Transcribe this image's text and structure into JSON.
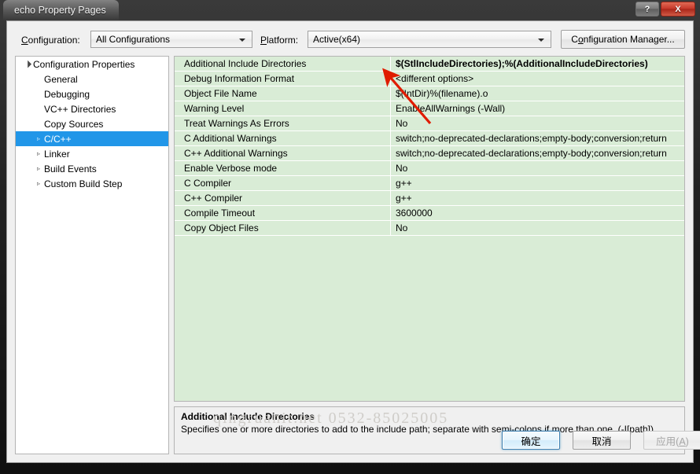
{
  "window": {
    "title": "echo Property Pages",
    "help_button": "?",
    "close_button": "X"
  },
  "toolbar": {
    "configuration_label": "Configuration:",
    "configuration_accel": "C",
    "configuration_value": "All Configurations",
    "platform_label": "Platform:",
    "platform_accel": "P",
    "platform_value": "Active(x64)",
    "config_manager_label": "Configuration Manager...",
    "config_manager_accel": "o"
  },
  "tree": {
    "items": [
      {
        "label": "Configuration Properties",
        "depth": 0,
        "twisty": "expanded",
        "selected": false
      },
      {
        "label": "General",
        "depth": 1,
        "twisty": "none",
        "selected": false
      },
      {
        "label": "Debugging",
        "depth": 1,
        "twisty": "none",
        "selected": false
      },
      {
        "label": "VC++ Directories",
        "depth": 1,
        "twisty": "none",
        "selected": false
      },
      {
        "label": "Copy Sources",
        "depth": 1,
        "twisty": "none",
        "selected": false
      },
      {
        "label": "C/C++",
        "depth": 1,
        "twisty": "collapsed",
        "selected": true
      },
      {
        "label": "Linker",
        "depth": 1,
        "twisty": "collapsed",
        "selected": false
      },
      {
        "label": "Build Events",
        "depth": 1,
        "twisty": "collapsed",
        "selected": false
      },
      {
        "label": "Custom Build Step",
        "depth": 1,
        "twisty": "collapsed",
        "selected": false
      }
    ]
  },
  "grid": {
    "rows": [
      {
        "name": "Additional Include Directories",
        "value": "$(StlIncludeDirectories);%(AdditionalIncludeDirectories)",
        "active": true
      },
      {
        "name": "Debug Information Format",
        "value": "<different options>",
        "active": false
      },
      {
        "name": "Object File Name",
        "value": "$(IntDir)%(filename).o",
        "active": false
      },
      {
        "name": "Warning Level",
        "value": "EnableAllWarnings (-Wall)",
        "active": false
      },
      {
        "name": "Treat Warnings As Errors",
        "value": "No",
        "active": false
      },
      {
        "name": "C Additional Warnings",
        "value": "switch;no-deprecated-declarations;empty-body;conversion;return",
        "active": false
      },
      {
        "name": "C++ Additional Warnings",
        "value": "switch;no-deprecated-declarations;empty-body;conversion;return",
        "active": false
      },
      {
        "name": "Enable Verbose mode",
        "value": "No",
        "active": false
      },
      {
        "name": "C Compiler",
        "value": "g++",
        "active": false
      },
      {
        "name": "C++ Compiler",
        "value": "g++",
        "active": false
      },
      {
        "name": "Compile Timeout",
        "value": "3600000",
        "active": false
      },
      {
        "name": "Copy Object Files",
        "value": "No",
        "active": false
      }
    ]
  },
  "description": {
    "title": "Additional Include Directories",
    "body": "Specifies one or more directories to add to the include path; separate with semi-colons if more than one. (-I[path])."
  },
  "watermark": {
    "text": "qingruanit.net  0532-85025005"
  },
  "buttons": {
    "ok": "确定",
    "cancel": "取消",
    "apply": "应用(",
    "apply_accel": "A",
    "apply_tail": ")"
  },
  "colors": {
    "grid_background": "#d9ecd6",
    "selection": "#2196e8",
    "annotation_arrow": "#e01b00",
    "close_button": "#c6382a"
  }
}
